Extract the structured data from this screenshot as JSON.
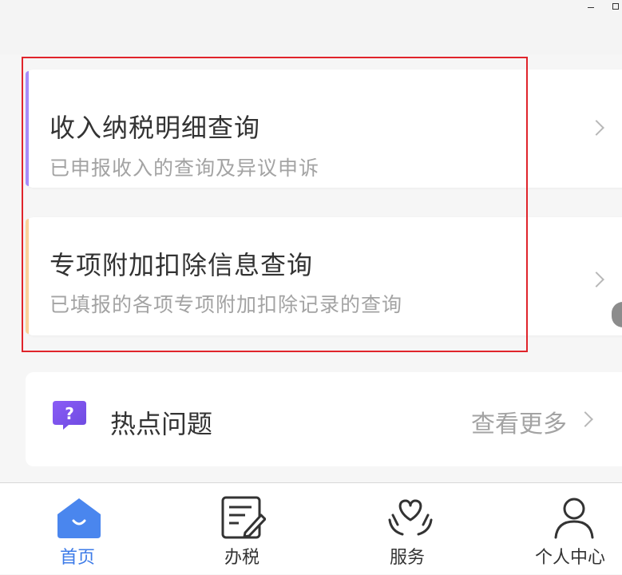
{
  "cards": [
    {
      "title": "收入纳税明细查询",
      "subtitle": "已申报收入的查询及异议申诉",
      "accent": "#a78bfa"
    },
    {
      "title": "专项附加扣除信息查询",
      "subtitle": "已填报的各项专项附加扣除记录的查询",
      "accent": "#fbd29a"
    }
  ],
  "hot": {
    "icon": "question-icon",
    "title": "热点问题",
    "more": "查看更多"
  },
  "tabbar": {
    "items": [
      {
        "label": "首页",
        "icon": "home-icon",
        "active": true
      },
      {
        "label": "办税",
        "icon": "tax-form-icon",
        "active": false
      },
      {
        "label": "服务",
        "icon": "heart-hands-icon",
        "active": false
      },
      {
        "label": "个人中心",
        "icon": "person-icon",
        "active": false
      }
    ]
  },
  "colors": {
    "active": "#3d7be8",
    "highlight": "#e0242b"
  }
}
